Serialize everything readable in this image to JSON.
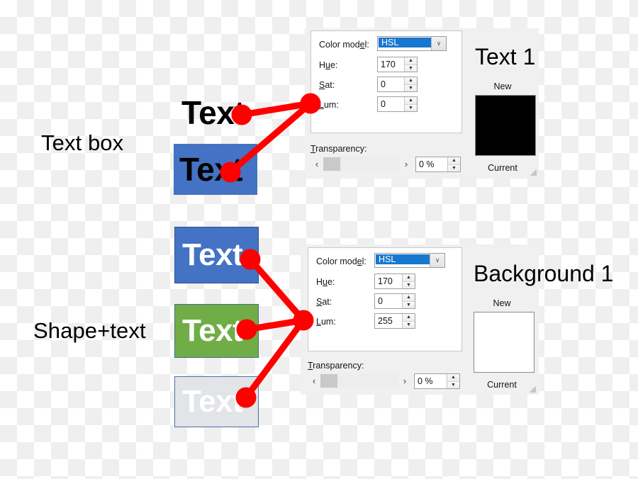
{
  "diagram": {
    "labels": {
      "textbox": "Text box",
      "shapetext": "Shape+text"
    },
    "samples": {
      "text_plain": "Text",
      "text_blue": "Text",
      "shape_blue": "Text",
      "shape_green": "Text",
      "shape_grey": "Text"
    },
    "colors": {
      "accent_blue": "#4472C4",
      "accent_green": "#70AD47",
      "light_grey": "#E2E4E8",
      "arrow_red": "#FF0000",
      "combo_highlight": "#1878CF"
    }
  },
  "dialog_top": {
    "color_model_label": "Color model:",
    "color_model_label_pre": "Color mod",
    "color_model_label_accel": "e",
    "color_model_label_post": "l:",
    "color_model_value": "HSL",
    "hue_label_pre": "H",
    "hue_label_accel": "u",
    "hue_label_post": "e:",
    "hue_value": "170",
    "sat_label_accel": "S",
    "sat_label_post": "at:",
    "sat_value": "0",
    "lum_label_accel": "L",
    "lum_label_post": "um:",
    "lum_value": "0",
    "transparency_label_accel": "T",
    "transparency_label_post": "ransparency:",
    "transparency_value": "0 %",
    "slider_left_arrow": "‹",
    "slider_right_arrow": "›",
    "preview_title": "Text 1",
    "new_caption": "New",
    "current_caption": "Current",
    "new_swatch_color": "#000000",
    "current_swatch_color": "#000000",
    "spin_up": "▲",
    "spin_down": "▼",
    "combo_chevron": "∨"
  },
  "dialog_bottom": {
    "color_model_label_pre": "Color mod",
    "color_model_label_accel": "e",
    "color_model_label_post": "l:",
    "color_model_value": "HSL",
    "hue_label_pre": "H",
    "hue_label_accel": "u",
    "hue_label_post": "e:",
    "hue_value": "170",
    "sat_label_accel": "S",
    "sat_label_post": "at:",
    "sat_value": "0",
    "lum_label_accel": "L",
    "lum_label_post": "um:",
    "lum_value": "255",
    "transparency_label_accel": "T",
    "transparency_label_post": "ransparency:",
    "transparency_value": "0 %",
    "slider_left_arrow": "‹",
    "slider_right_arrow": "›",
    "preview_title": "Background 1",
    "new_caption": "New",
    "current_caption": "Current",
    "new_swatch_color": "#FFFFFF",
    "spin_up": "▲",
    "spin_down": "▼",
    "combo_chevron": "∨"
  }
}
